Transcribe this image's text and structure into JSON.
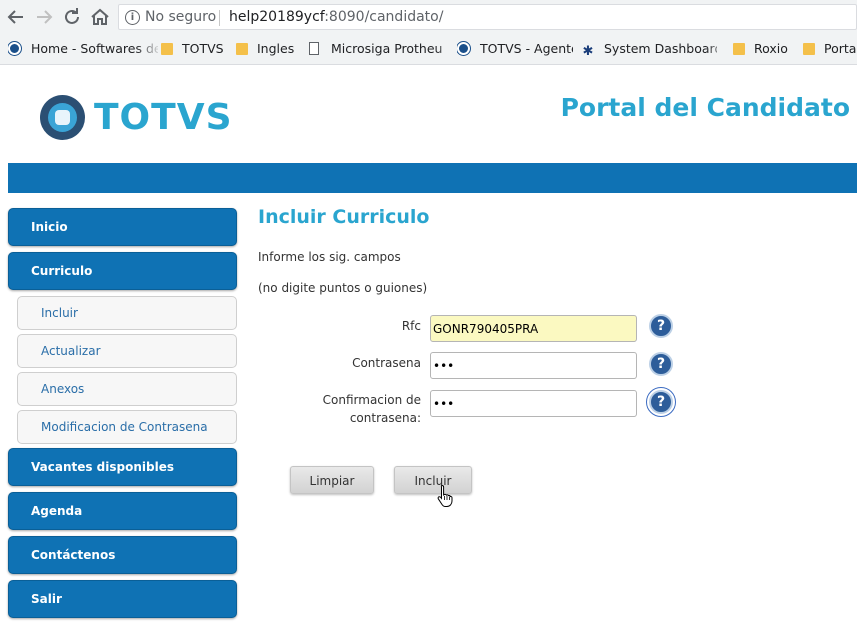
{
  "browser": {
    "insecure_label": "No seguro",
    "url_host": "help20189ycf",
    "url_path": ":8090/candidato/",
    "icons": [
      "back-icon",
      "forward-icon",
      "reload-icon",
      "home-icon",
      "info-icon"
    ]
  },
  "bookmarks": [
    {
      "label": "Home - Softwares de",
      "icon": "circle-logo-icon"
    },
    {
      "label": "TOTVS",
      "icon": "folder-icon"
    },
    {
      "label": "Ingles",
      "icon": "folder-icon"
    },
    {
      "label": "Microsiga Protheus T",
      "icon": "page-icon"
    },
    {
      "label": "TOTVS - Agente",
      "icon": "circle-logo-icon"
    },
    {
      "label": "System Dashboard -",
      "icon": "dashboard-icon"
    },
    {
      "label": "Roxio",
      "icon": "folder-icon"
    },
    {
      "label": "Porta",
      "icon": "folder-icon"
    }
  ],
  "header": {
    "logo_text": "TOTVS",
    "portal_title": "Portal del Candidato"
  },
  "menu": {
    "inicio": "Inicio",
    "curriculo": "Curriculo",
    "sub": {
      "incluir": "Incluir",
      "actualizar": "Actualizar",
      "anexos": "Anexos",
      "modificacion": "Modificacion de Contrasena"
    },
    "vacantes": "Vacantes disponibles",
    "agenda": "Agenda",
    "contactenos": "Contáctenos",
    "salir": "Salir"
  },
  "form": {
    "title": "Incluir Curriculo",
    "hint1": "Informe los sig. campos",
    "hint2": "(no digite puntos o guiones)",
    "rfc_label": "Rfc",
    "rfc_value": "GONR790405PRA",
    "password_label": "Contrasena",
    "password_value": "abc",
    "confirm_label_line1": "Confirmacion de",
    "confirm_label_line2": "contrasena:",
    "confirm_value": "abc",
    "help_glyph": "?",
    "clear_button": "Limpiar",
    "submit_button": "Incluir"
  },
  "colors": {
    "brand_blue": "#0f72b4",
    "title_cyan": "#2aa5cf",
    "autofill_yellow": "#fbf9c1"
  }
}
